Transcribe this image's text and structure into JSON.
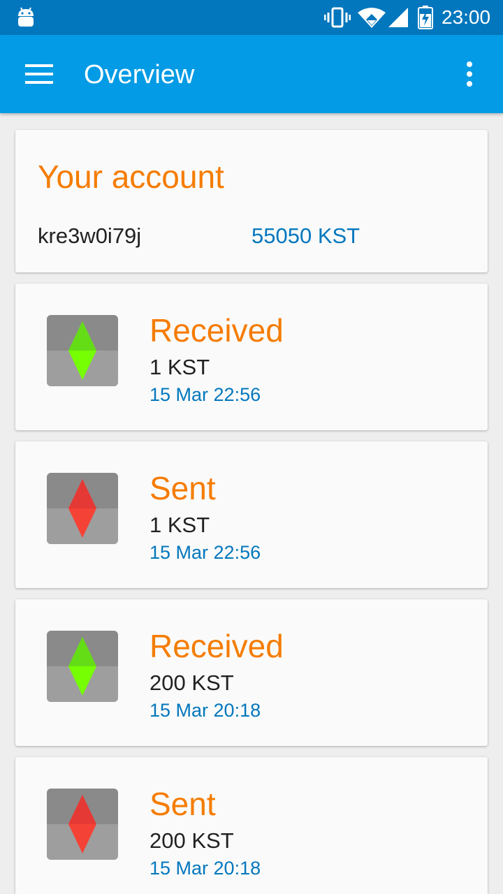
{
  "status_bar": {
    "time": "23:00",
    "icons": [
      "android-icon",
      "vibrate-icon",
      "wifi-icon",
      "signal-icon",
      "battery-charging-icon"
    ]
  },
  "toolbar": {
    "title": "Overview",
    "menu_icon": "menu-icon",
    "more_icon": "more-vert-icon"
  },
  "account": {
    "heading": "Your account",
    "address": "kre3w0i79j",
    "balance": "55050 KST"
  },
  "transactions": [
    {
      "type": "Received",
      "amount": "1 KST",
      "date": "15 Mar 22:56",
      "icon": "received-arrow-icon"
    },
    {
      "type": "Sent",
      "amount": "1 KST",
      "date": "15 Mar 22:56",
      "icon": "sent-arrow-icon"
    },
    {
      "type": "Received",
      "amount": "200 KST",
      "date": "15 Mar 20:18",
      "icon": "received-arrow-icon"
    },
    {
      "type": "Sent",
      "amount": "200 KST",
      "date": "15 Mar 20:18",
      "icon": "sent-arrow-icon"
    }
  ],
  "colors": {
    "status_bar": "#0277bd",
    "toolbar": "#039be5",
    "accent_orange": "#f57c00",
    "link_blue": "#0277bd",
    "received_green": "#76ff03",
    "sent_red": "#f44336"
  }
}
